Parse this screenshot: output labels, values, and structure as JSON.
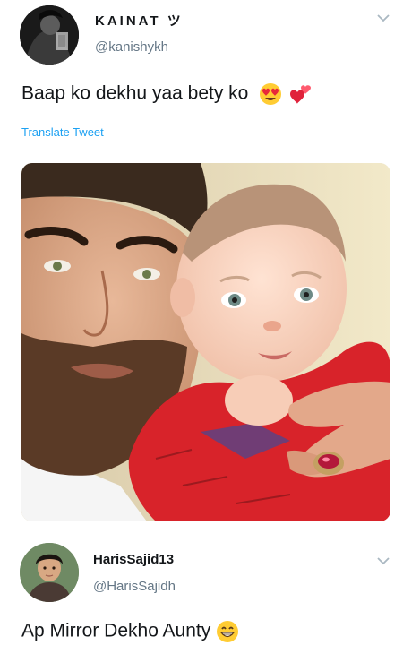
{
  "tweet": {
    "author_name": "KAINAT ツ",
    "author_handle": "@kanishykh",
    "text": "Baap ko dekhu yaa bety ko",
    "emojis": [
      "heart-eyes-emoji",
      "revolving-hearts-emoji"
    ],
    "translate_label": "Translate Tweet"
  },
  "reply": {
    "author_name": "HarisSajid13",
    "author_handle": "@HarisSajidh",
    "text": "Ap Mirror Dekho Aunty",
    "emoji": "grinning-emoji"
  },
  "colors": {
    "link": "#1da1f2",
    "secondary_text": "#657786",
    "divider": "#e6ecf0"
  }
}
